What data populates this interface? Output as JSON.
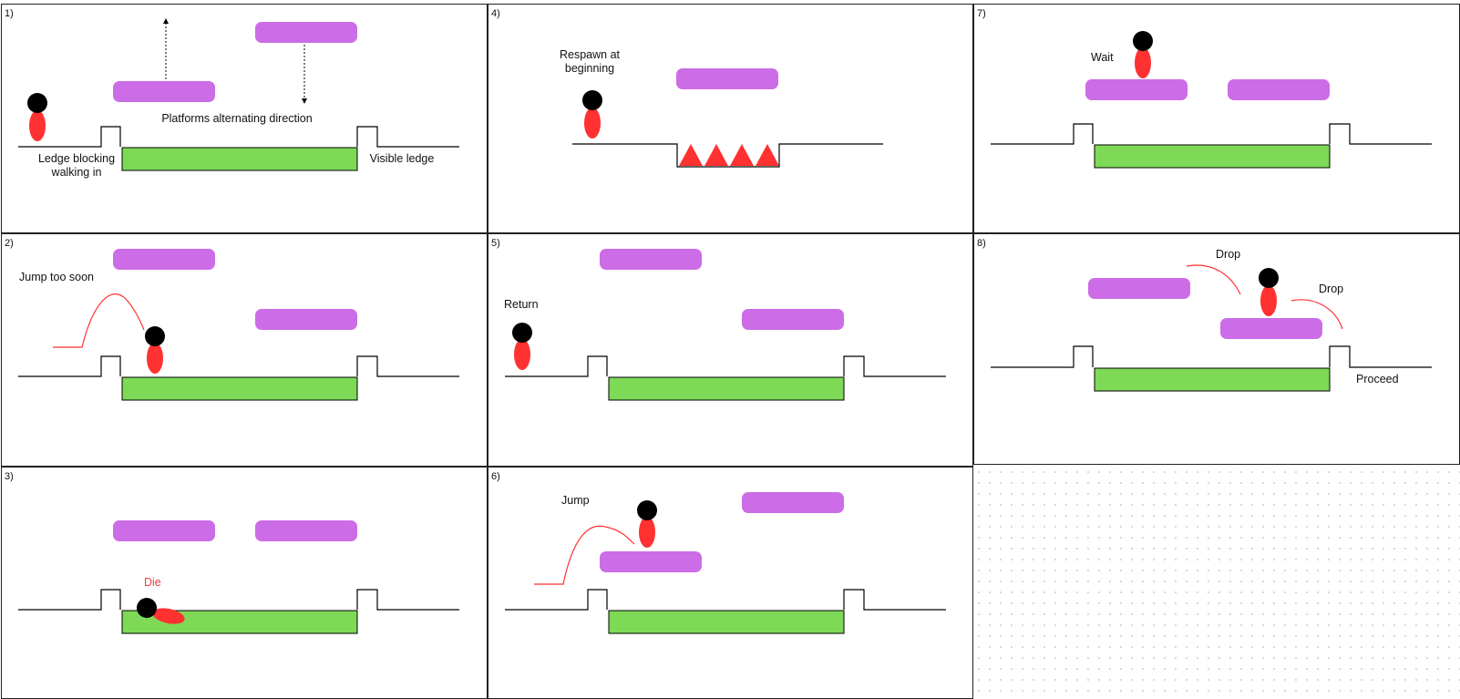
{
  "colors": {
    "platform": "#cc6ce6",
    "water": "#7ed957",
    "body": "#ff3131",
    "head": "#000000",
    "line": "#000000",
    "spike": "#ff3131",
    "arc": "#ff3131",
    "die_label": "#ff3131"
  },
  "panels": [
    {
      "id": "1",
      "number": "1)",
      "labels": {
        "ledge_blocking": "Ledge blocking\nwalking in",
        "platforms_alternating": "Platforms alternating direction",
        "visible_ledge": "Visible ledge"
      }
    },
    {
      "id": "2",
      "number": "2)",
      "labels": {
        "jump_too_soon": "Jump too soon"
      }
    },
    {
      "id": "3",
      "number": "3)",
      "labels": {
        "die": "Die"
      }
    },
    {
      "id": "4",
      "number": "4)",
      "labels": {
        "respawn": "Respawn at\nbeginning"
      }
    },
    {
      "id": "5",
      "number": "5)",
      "labels": {
        "return": "Return"
      }
    },
    {
      "id": "6",
      "number": "6)",
      "labels": {
        "jump": "Jump"
      }
    },
    {
      "id": "7",
      "number": "7)",
      "labels": {
        "wait": "Wait"
      }
    },
    {
      "id": "8",
      "number": "8)",
      "labels": {
        "drop_left": "Drop",
        "drop_right": "Drop",
        "proceed": "Proceed"
      }
    }
  ]
}
